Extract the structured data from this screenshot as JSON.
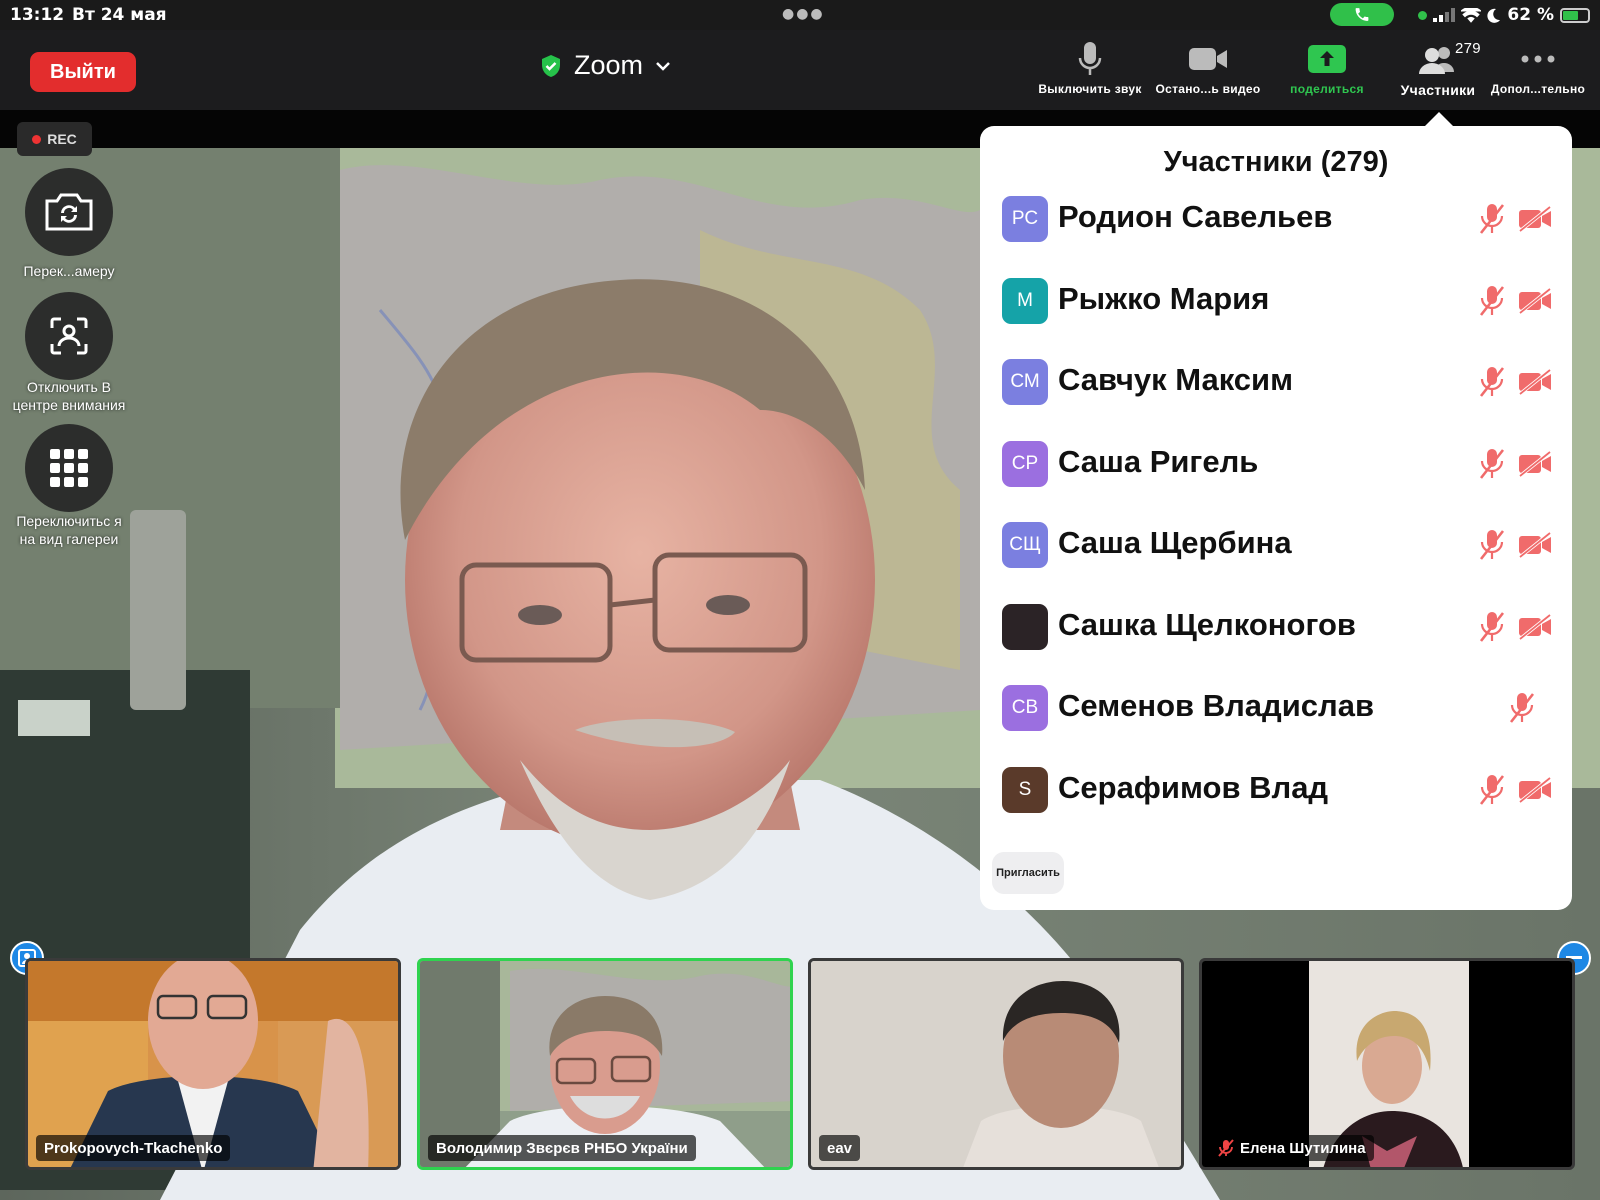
{
  "status_bar": {
    "time": "13:12",
    "date": "Вт 24 мая",
    "battery": "62 %",
    "battery_level": 0.62
  },
  "toolbar": {
    "leave_label": "Выйти",
    "meeting_title": "Zoom",
    "mute_label": "Выключить звук",
    "video_label": "Остано...ь видео",
    "share_label": "поделиться",
    "participants_label": "Участники",
    "participants_count": "279",
    "more_label": "Допол...тельно"
  },
  "side": {
    "rec_label": "REC",
    "switch_camera_label": "Перек...амеру",
    "spotlight_label": "Отключить В центре внимания",
    "gallery_label": "Переключитьс я на вид галереи"
  },
  "panel": {
    "title": "Участники (279)",
    "invite_label": "Пригласить",
    "participants": [
      {
        "initials": "РС",
        "name": "Родион Савельев",
        "color": "#7b7fe0",
        "video_off": true
      },
      {
        "initials": "М",
        "name": "Рыжко Мария",
        "color": "#15a3a8",
        "video_off": true
      },
      {
        "initials": "СМ",
        "name": "Савчук Максим",
        "color": "#7b7fe0",
        "video_off": true
      },
      {
        "initials": "СР",
        "name": "Саша Ригель",
        "color": "#9b6fe0",
        "video_off": true
      },
      {
        "initials": "СЩ",
        "name": "Саша Щербина",
        "color": "#7b7fe0",
        "video_off": true
      },
      {
        "initials": "",
        "name": "Сашка Щелконогов",
        "color": "#2b2326",
        "video_off": true
      },
      {
        "initials": "СВ",
        "name": "Семенов Владислав",
        "color": "#9b6fe0",
        "video_off": false
      },
      {
        "initials": "S",
        "name": "Серафимов Влад",
        "color": "#5a3a2a",
        "video_off": true
      }
    ]
  },
  "thumbnails": [
    {
      "name": "Prokopovych-Tkachenko",
      "active": false,
      "muted": false
    },
    {
      "name": "Володимир Звєрєв РНБО України",
      "active": true,
      "muted": false
    },
    {
      "name": "eav",
      "active": false,
      "muted": false
    },
    {
      "name": "Елена Шутилина",
      "active": false,
      "muted": true
    }
  ]
}
